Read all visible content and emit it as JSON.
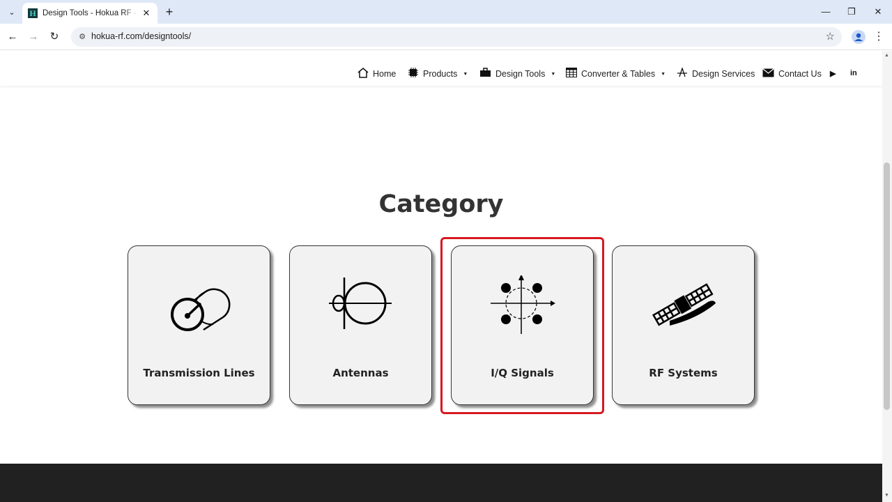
{
  "browser": {
    "tab_title": "Design Tools - Hokua RF - Tools",
    "favicon_letter": "H",
    "url": "hokua-rf.com/designtools/",
    "tab_close": "✕",
    "new_tab": "+"
  },
  "nav": {
    "items": [
      {
        "label": "Home",
        "icon": "home-icon"
      },
      {
        "label": "Products",
        "icon": "chip-icon"
      },
      {
        "label": "Design Tools",
        "icon": "toolbox-icon"
      },
      {
        "label": "Converter & Tables",
        "icon": "table-icon"
      },
      {
        "label": "Design Services",
        "icon": "antenna-icon"
      },
      {
        "label": "Contact Us",
        "icon": "envelope-icon"
      }
    ],
    "social": {
      "youtube": "▶",
      "linkedin": "in"
    }
  },
  "main": {
    "heading": "Category",
    "cards": [
      {
        "label": "Transmission Lines",
        "icon": "transmission-line-icon"
      },
      {
        "label": "Antennas",
        "icon": "antenna-pattern-icon"
      },
      {
        "label": "I/Q Signals",
        "icon": "iq-constellation-icon"
      },
      {
        "label": "RF Systems",
        "icon": "satellite-icon"
      }
    ],
    "highlighted_card": "I/Q Signals"
  },
  "colors": {
    "highlight": "#d7191f",
    "footer": "#212121",
    "tabbar": "#dfe8f7"
  }
}
